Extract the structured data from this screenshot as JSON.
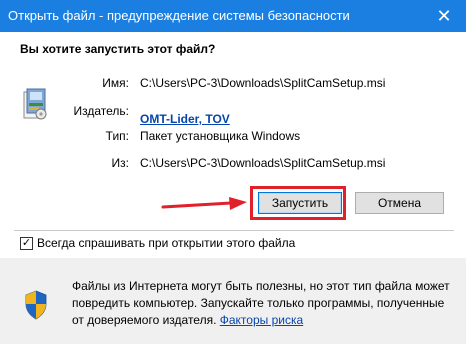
{
  "window": {
    "title": "Открыть файл - предупреждение системы безопасности",
    "close_glyph": "✕"
  },
  "question": "Вы хотите запустить этот файл?",
  "details": {
    "name_label": "Имя:",
    "name_value": "C:\\Users\\PC-3\\Downloads\\SplitCamSetup.msi",
    "publisher_label": "Издатель:",
    "publisher_value": "OMT-Lider, TOV",
    "type_label": "Тип:",
    "type_value": "Пакет установщика Windows",
    "from_label": "Из:",
    "from_value": "C:\\Users\\PC-3\\Downloads\\SplitCamSetup.msi"
  },
  "buttons": {
    "run_label": "Запустить",
    "cancel_label": "Отмена"
  },
  "checkbox": {
    "checked_glyph": "✓",
    "label": "Всегда спрашивать при открытии этого файла"
  },
  "warning": {
    "text": "Файлы из Интернета могут быть полезны, но этот тип файла может повредить компьютер. Запускайте только программы, полученные от доверяемого издателя. ",
    "link": "Факторы риска"
  },
  "colors": {
    "titlebar": "#1a7fe0",
    "highlight_frame": "#e0202a",
    "link": "#0645ad"
  }
}
